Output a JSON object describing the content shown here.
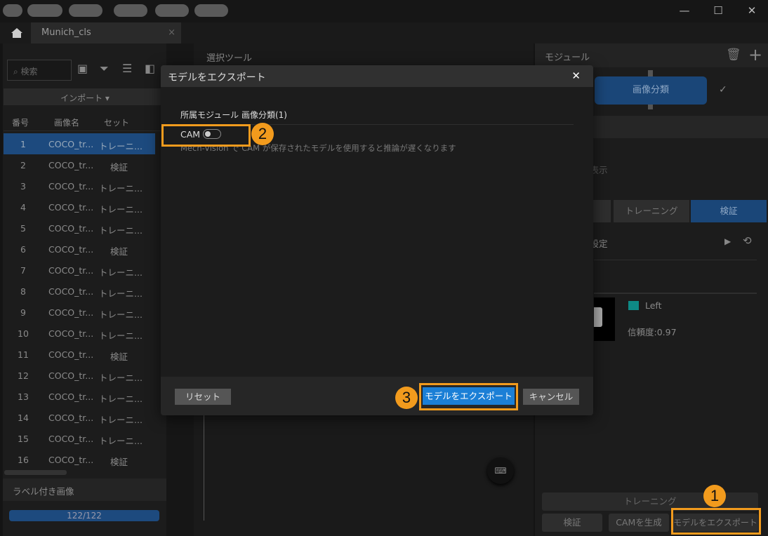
{
  "window": {
    "tab_title": "Munich_cls",
    "tab_close": "×",
    "minimize": "—",
    "maximize": "☐",
    "close": "✕"
  },
  "left": {
    "search_placeholder": "検索",
    "import_label": "インポート",
    "columns": [
      "番号",
      "画像名",
      "セット"
    ],
    "rows": [
      {
        "no": "1",
        "name": "COCO_tr...",
        "set": "トレーニ..."
      },
      {
        "no": "2",
        "name": "COCO_tr...",
        "set": "検証"
      },
      {
        "no": "3",
        "name": "COCO_tr...",
        "set": "トレーニ..."
      },
      {
        "no": "4",
        "name": "COCO_tr...",
        "set": "トレーニ..."
      },
      {
        "no": "5",
        "name": "COCO_tr...",
        "set": "トレーニ..."
      },
      {
        "no": "6",
        "name": "COCO_tr...",
        "set": "検証"
      },
      {
        "no": "7",
        "name": "COCO_tr...",
        "set": "トレーニ..."
      },
      {
        "no": "8",
        "name": "COCO_tr...",
        "set": "トレーニ..."
      },
      {
        "no": "9",
        "name": "COCO_tr...",
        "set": "トレーニ..."
      },
      {
        "no": "10",
        "name": "COCO_tr...",
        "set": "トレーニ..."
      },
      {
        "no": "11",
        "name": "COCO_tr...",
        "set": "検証"
      },
      {
        "no": "12",
        "name": "COCO_tr...",
        "set": "トレーニ..."
      },
      {
        "no": "13",
        "name": "COCO_tr...",
        "set": "トレーニ..."
      },
      {
        "no": "14",
        "name": "COCO_tr...",
        "set": "トレーニ..."
      },
      {
        "no": "15",
        "name": "COCO_tr...",
        "set": "トレーニ..."
      },
      {
        "no": "16",
        "name": "COCO_tr...",
        "set": "検証"
      }
    ],
    "labeled_title": "ラベル付き画像",
    "labeled_progress": "122/122",
    "labeled_fraction": 1.0
  },
  "middle": {
    "title": "選択ツール"
  },
  "right": {
    "title": "モジュール",
    "module": "画像分類",
    "show_label": "を表示",
    "tabs": [
      "トレーニング",
      "検証"
    ],
    "param_label": "タ設定",
    "result_class": "Left",
    "result_color": "#0e8a86",
    "confidence": "信頼度:0.97",
    "train_button": "トレーニング",
    "verify_button": "検証",
    "cam_button": "CAMを生成",
    "export_button": "モデルをエクスポート"
  },
  "dialog": {
    "title": "モデルをエクスポート",
    "close": "✕",
    "module_label": "所属モジュール 画像分類(1)",
    "cam_label": "CAM",
    "cam_enabled": false,
    "note": "Mech-Vision で CAM が保存されたモデルを使用すると推論が遅くなります",
    "reset": "リセット",
    "export": "モデルをエクスポート",
    "cancel": "キャンセル"
  },
  "annotations": {
    "step1": "1",
    "step2": "2",
    "step3": "3",
    "color": "#f29b1d"
  }
}
